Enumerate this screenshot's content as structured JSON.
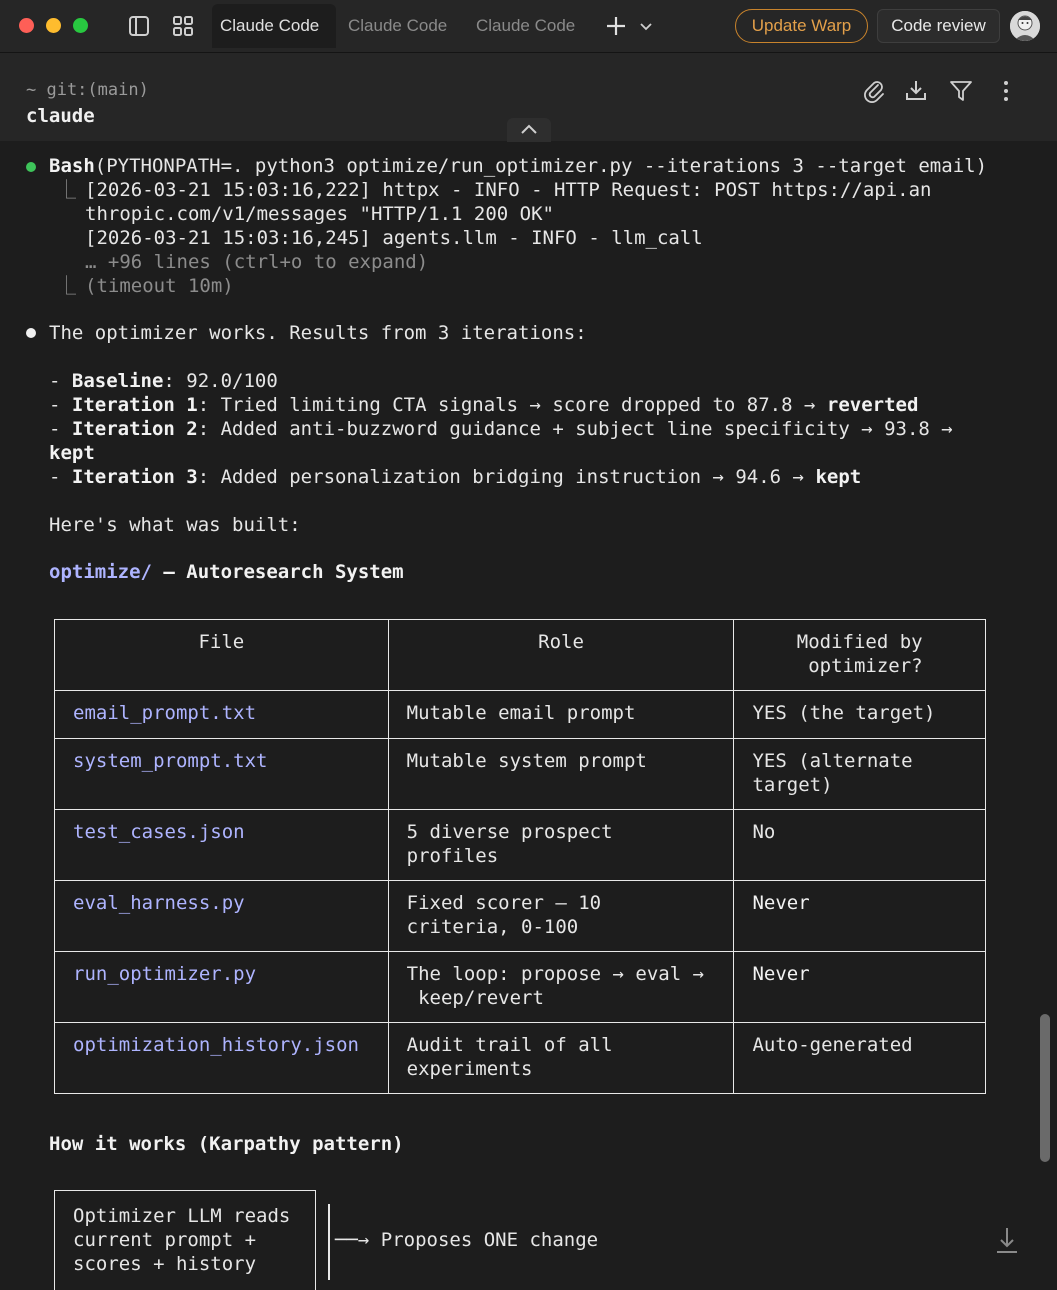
{
  "titlebar": {
    "tabs": [
      "Claude Code",
      "Claude Code",
      "Claude Code"
    ],
    "update_label": "Update Warp",
    "review_label": "Code review"
  },
  "header": {
    "prompt": "~ git:(main)",
    "command": "claude"
  },
  "bash": {
    "tool": "Bash",
    "args": "(PYTHONPATH=. python3 optimize/run_optimizer.py --iterations 3 --target email)",
    "out1": "[2026-03-21 15:03:16,222] httpx - INFO - HTTP Request: POST https://api.an",
    "out2": "thropic.com/v1/messages \"HTTP/1.1 200 OK\"",
    "out3": "[2026-03-21 15:03:16,245] agents.llm - INFO - llm_call",
    "more": "… +96 lines (ctrl+o to expand)",
    "timeout": "(timeout 10m)"
  },
  "response": {
    "intro": "The optimizer works. Results from 3 iterations:",
    "baseline_label": "Baseline",
    "baseline_value": ": 92.0/100",
    "it1_label": "Iteration 1",
    "it1_text": ": Tried limiting CTA signals → score dropped to 87.8 → ",
    "it1_result": "reverted",
    "it2_label": "Iteration 2",
    "it2_text": ": Added anti-buzzword guidance + subject line specificity → 93.8 →",
    "it2_result": "kept",
    "it3_label": "Iteration 3",
    "it3_text": ": Added personalization bridging instruction → 94.6 → ",
    "it3_result": "kept",
    "built": "Here's what was built:",
    "section_path": "optimize/",
    "section_title": " — Autoresearch System",
    "how_title": "How it works (Karpathy pattern)",
    "flow_box": [
      "Optimizer LLM reads",
      "current prompt +",
      "scores + history"
    ],
    "flow_arrow": "──→ Proposes ONE change"
  },
  "table": {
    "headers": [
      "File",
      "Role",
      "Modified by\n optimizer?"
    ],
    "rows": [
      {
        "file": "email_prompt.txt",
        "role": "Mutable email prompt",
        "mod": "YES (the target)"
      },
      {
        "file": "system_prompt.txt",
        "role": "Mutable system prompt",
        "mod": "YES (alternate\ntarget)"
      },
      {
        "file": "test_cases.json",
        "role": "5 diverse prospect\nprofiles",
        "mod": "No"
      },
      {
        "file": "eval_harness.py",
        "role": "Fixed scorer — 10\ncriteria, 0-100",
        "mod": "Never"
      },
      {
        "file": "run_optimizer.py",
        "role": "The loop: propose → eval →\n keep/revert",
        "mod": "Never"
      },
      {
        "file": "optimization_history.json",
        "role": "Audit trail of all\nexperiments",
        "mod": "Auto-generated"
      }
    ]
  },
  "colors": {
    "green_dot": "#3ec45a",
    "accent_purple": "#aeb4ff",
    "update_orange": "#e3a04a"
  }
}
